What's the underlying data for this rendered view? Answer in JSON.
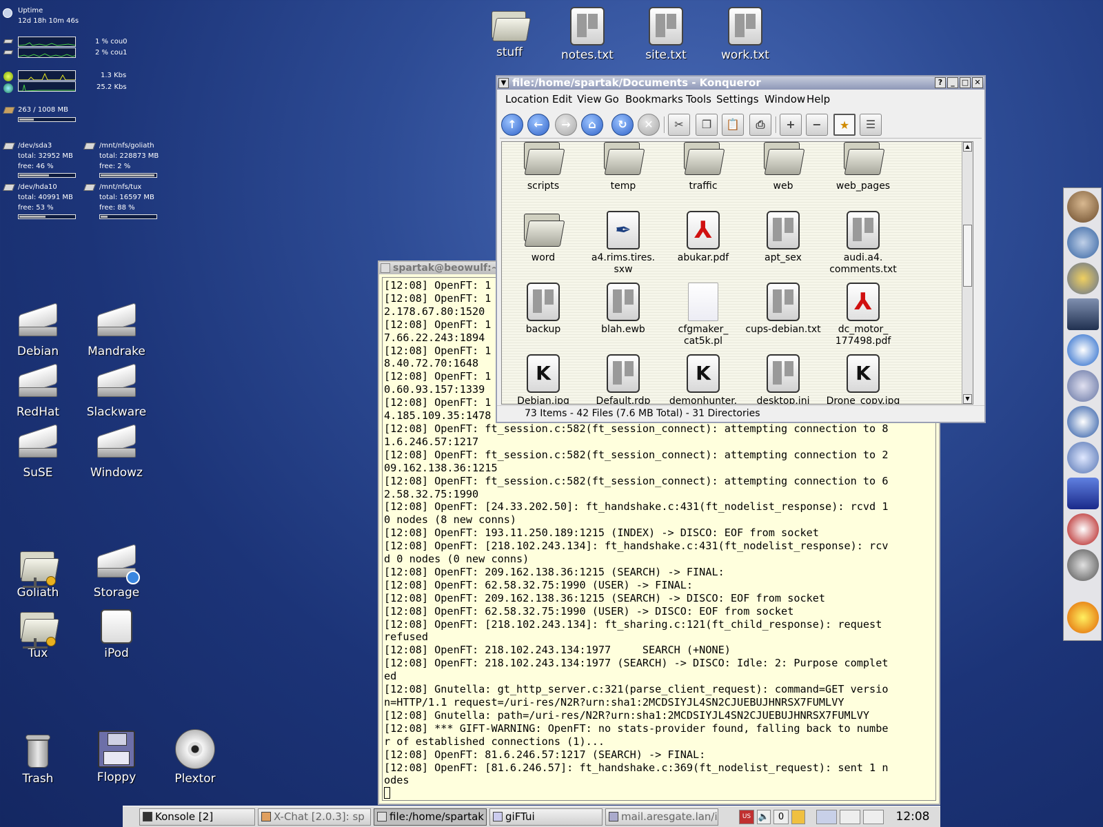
{
  "sysmon": {
    "uptime_label": "Uptime",
    "uptime_value": "12d 18h 10m 46s",
    "cpu0": "1 % cou0",
    "cpu1": "2 % cou1",
    "net_up": "1.3 Kbs",
    "net_down": "25.2 Kbs",
    "memory": "263 / 1008 MB",
    "memory_used_fraction": 0.26,
    "disks": [
      {
        "name": "/dev/sda3",
        "total": "total: 32952 MB",
        "free": "free: 46 %",
        "used_fraction": 0.54
      },
      {
        "name": "/mnt/nfs/goliath",
        "total": "total: 228873 MB",
        "free": "free: 2 %",
        "used_fraction": 0.98
      },
      {
        "name": "/dev/hda10",
        "total": "total: 40991 MB",
        "free": "free: 53 %",
        "used_fraction": 0.47
      },
      {
        "name": "/mnt/nfs/tux",
        "total": "total: 16597 MB",
        "free": "free: 88 %",
        "used_fraction": 0.12
      }
    ]
  },
  "desktop_icons": {
    "stuff": "stuff",
    "notes": "notes.txt",
    "site": "site.txt",
    "work": "work.txt",
    "debian": "Debian",
    "mandrake": "Mandrake",
    "redhat": "RedHat",
    "slackware": "Slackware",
    "suse": "SuSE",
    "windowz": "Windowz",
    "goliath": "Goliath",
    "storage": "Storage",
    "tux": "Tux",
    "ipod": "iPod",
    "trash": "Trash",
    "floppy": "Floppy",
    "plextor": "Plextor"
  },
  "konsole": {
    "title": "spartak@beowulf:~",
    "lines": [
      "[12:08] OpenFT: 1",
      "[12:08] OpenFT: 1",
      "2.178.67.80:1520",
      "[12:08] OpenFT: 1",
      "7.66.22.243:1894",
      "[12:08] OpenFT: 1",
      "8.40.72.70:1648",
      "[12:08] OpenFT: 1",
      "0.60.93.157:1339",
      "[12:08] OpenFT: 1",
      "4.185.109.35:1478",
      "[12:08] OpenFT: ft_session.c:582(ft_session_connect): attempting connection to 8",
      "1.6.246.57:1217",
      "[12:08] OpenFT: ft_session.c:582(ft_session_connect): attempting connection to 2",
      "09.162.138.36:1215",
      "[12:08] OpenFT: ft_session.c:582(ft_session_connect): attempting connection to 6",
      "2.58.32.75:1990",
      "[12:08] OpenFT: [24.33.202.50]: ft_handshake.c:431(ft_nodelist_response): rcvd 1",
      "0 nodes (8 new conns)",
      "[12:08] OpenFT: 193.11.250.189:1215 (INDEX) -> DISCO: EOF from socket",
      "[12:08] OpenFT: [218.102.243.134]: ft_handshake.c:431(ft_nodelist_response): rcv",
      "d 0 nodes (0 new conns)",
      "[12:08] OpenFT: 209.162.138.36:1215 (SEARCH) -> FINAL:",
      "[12:08] OpenFT: 62.58.32.75:1990 (USER) -> FINAL:",
      "[12:08] OpenFT: 209.162.138.36:1215 (SEARCH) -> DISCO: EOF from socket",
      "[12:08] OpenFT: 62.58.32.75:1990 (USER) -> DISCO: EOF from socket",
      "[12:08] OpenFT: [218.102.243.134]: ft_sharing.c:121(ft_child_response): request",
      "refused",
      "[12:08] OpenFT: 218.102.243.134:1977     SEARCH (+NONE)",
      "[12:08] OpenFT: 218.102.243.134:1977 (SEARCH) -> DISCO: Idle: 2: Purpose complet",
      "ed",
      "[12:08] Gnutella: gt_http_server.c:321(parse_client_request): command=GET versio",
      "n=HTTP/1.1 request=/uri-res/N2R?urn:sha1:2MCDSIYJL4SN2CJUEBUJHNRSX7FUMLVY",
      "[12:08] Gnutella: path=/uri-res/N2R?urn:sha1:2MCDSIYJL4SN2CJUEBUJHNRSX7FUMLVY",
      "[12:08] *** GIFT-WARNING: OpenFT: no stats-provider found, falling back to numbe",
      "r of established connections (1)...",
      "[12:08] OpenFT: 81.6.246.57:1217 (SEARCH) -> FINAL:",
      "[12:08] OpenFT: [81.6.246.57]: ft_handshake.c:369(ft_nodelist_request): sent 1 n",
      "odes"
    ]
  },
  "konqueror": {
    "title": "file:/home/spartak/Documents - Konqueror",
    "menu": [
      "Location",
      "Edit",
      "View",
      "Go",
      "Bookmarks",
      "Tools",
      "Settings",
      "Window",
      "Help"
    ],
    "files": [
      {
        "name": "scripts",
        "kind": "folder"
      },
      {
        "name": "temp",
        "kind": "folder"
      },
      {
        "name": "traffic",
        "kind": "folder"
      },
      {
        "name": "web",
        "kind": "folder"
      },
      {
        "name": "web_pages",
        "kind": "folder"
      },
      {
        "name": "word",
        "kind": "folder"
      },
      {
        "name": "a4.rims.tires.\nsxw",
        "kind": "sxw"
      },
      {
        "name": "abukar.pdf",
        "kind": "pdf"
      },
      {
        "name": "apt_sex",
        "kind": "txt"
      },
      {
        "name": "audi.a4.\ncomments.txt",
        "kind": "txt"
      },
      {
        "name": "backup",
        "kind": "txt"
      },
      {
        "name": "blah.ewb",
        "kind": "txt"
      },
      {
        "name": "cfgmaker_\ncat5k.pl",
        "kind": "script"
      },
      {
        "name": "cups-debian.txt",
        "kind": "txt"
      },
      {
        "name": "dc_motor_\n177498.pdf",
        "kind": "pdf"
      },
      {
        "name": "Debian.jpg",
        "kind": "jpg"
      },
      {
        "name": "Default.rdp",
        "kind": "txt"
      },
      {
        "name": "demonhunter.",
        "kind": "jpg"
      },
      {
        "name": "desktop.ini",
        "kind": "txt"
      },
      {
        "name": "Drone_copy.jpg",
        "kind": "jpg"
      }
    ],
    "status": "73 Items - 42 Files (7.6 MB Total) - 31 Directories"
  },
  "taskbar": {
    "tasks": [
      "Konsole [2]",
      "X-Chat [2.0.3]: sp",
      "file:/home/spartak",
      "giFTui",
      "mail.aresgate.lan/i"
    ],
    "tray_count": "0",
    "clock": "12:08 pm"
  }
}
